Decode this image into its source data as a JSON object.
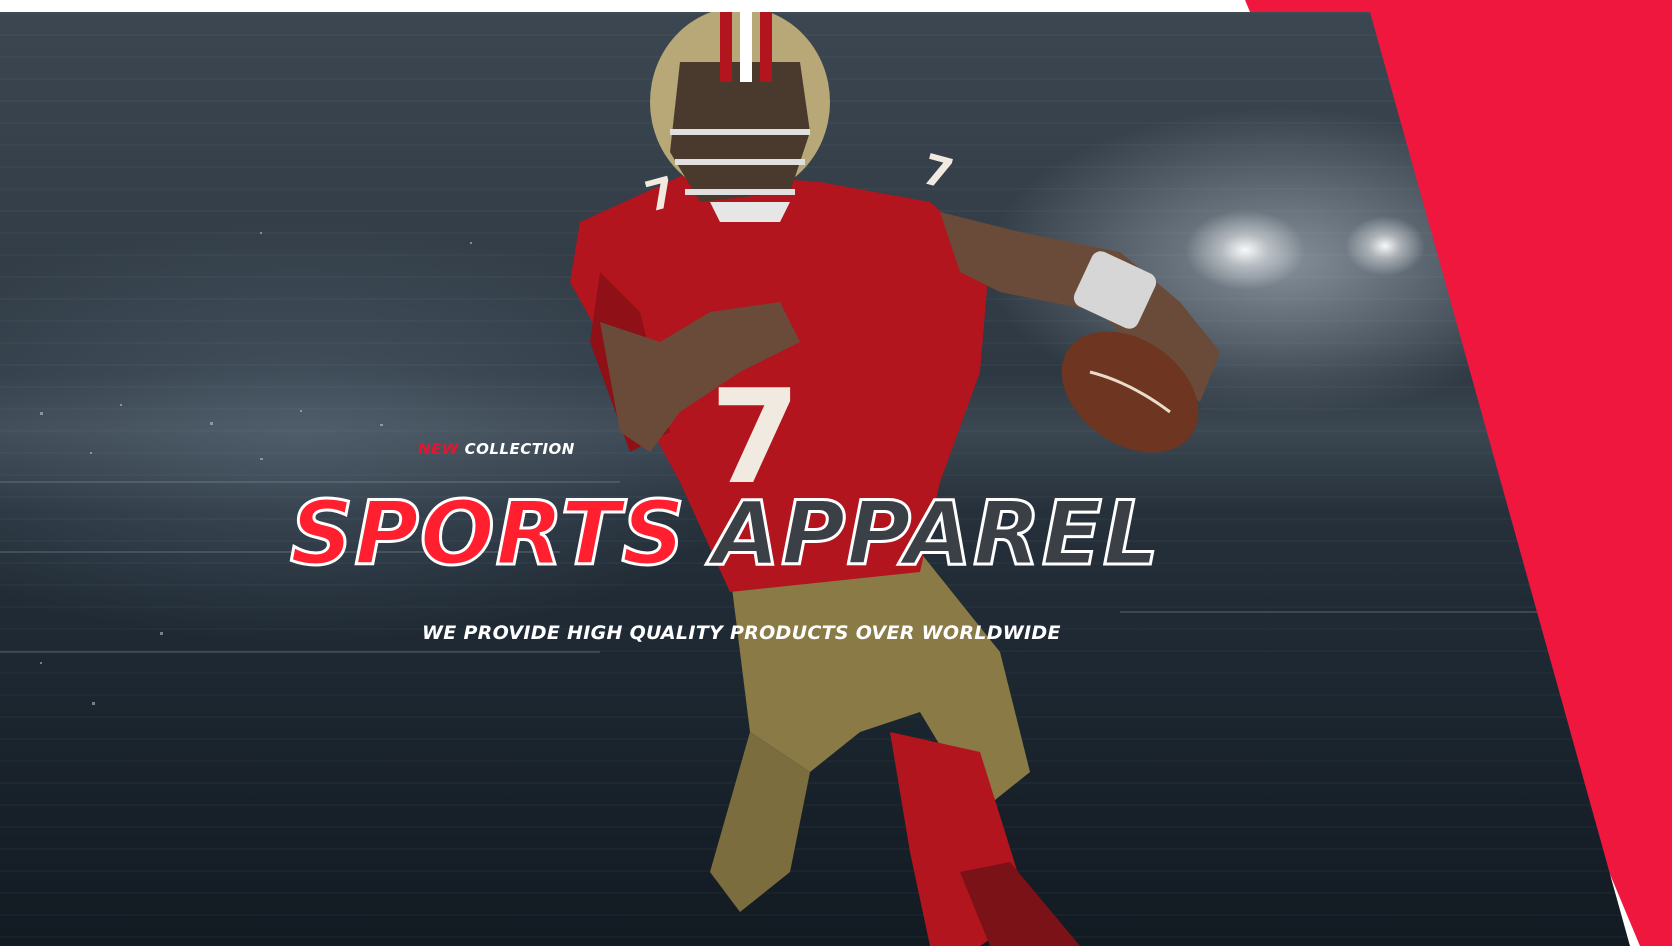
{
  "hero": {
    "kicker_highlight": "NEW",
    "kicker_rest": "COLLECTION",
    "headline_word_1": "SPORTS",
    "headline_word_2": "APPAREL",
    "tagline": "WE PROVIDE HIGH QUALITY PRODUCTS OVER WORLDWIDE",
    "player_jersey_number": "7"
  },
  "colors": {
    "accent": "#f0173f",
    "headline_red": "#ff1f2f",
    "background_dark": "#1f2a34",
    "jersey_red": "#b2151d",
    "pants_gold": "#8a7a46"
  },
  "icons": {
    "football": "football-icon",
    "player": "football-player-image"
  }
}
